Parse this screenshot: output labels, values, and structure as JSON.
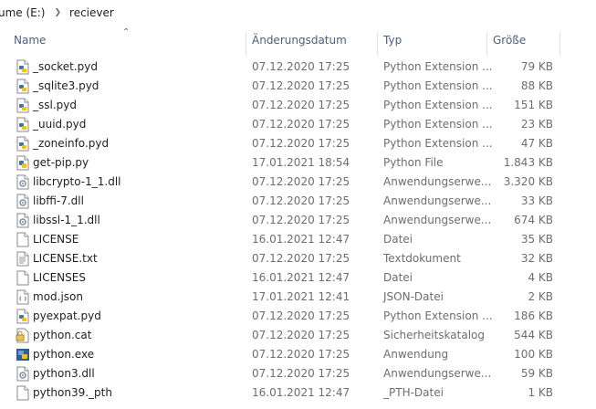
{
  "breadcrumb": {
    "volume": "ume (E:)",
    "folder": "reciever"
  },
  "columns": {
    "name": "Name",
    "date": "Änderungsdatum",
    "type": "Typ",
    "size": "Größe"
  },
  "files": [
    {
      "name": "_socket.pyd",
      "date": "07.12.2020 17:25",
      "type": "Python Extension ...",
      "size": "79 KB",
      "icon": "python-extension-icon"
    },
    {
      "name": "_sqlite3.pyd",
      "date": "07.12.2020 17:25",
      "type": "Python Extension ...",
      "size": "88 KB",
      "icon": "python-extension-icon"
    },
    {
      "name": "_ssl.pyd",
      "date": "07.12.2020 17:25",
      "type": "Python Extension ...",
      "size": "151 KB",
      "icon": "python-extension-icon"
    },
    {
      "name": "_uuid.pyd",
      "date": "07.12.2020 17:25",
      "type": "Python Extension ...",
      "size": "23 KB",
      "icon": "python-extension-icon"
    },
    {
      "name": "_zoneinfo.pyd",
      "date": "07.12.2020 17:25",
      "type": "Python Extension ...",
      "size": "47 KB",
      "icon": "python-extension-icon"
    },
    {
      "name": "get-pip.py",
      "date": "17.01.2021 18:54",
      "type": "Python File",
      "size": "1.843 KB",
      "icon": "python-file-icon"
    },
    {
      "name": "libcrypto-1_1.dll",
      "date": "07.12.2020 17:25",
      "type": "Anwendungserwe...",
      "size": "3.320 KB",
      "icon": "dll-file-icon"
    },
    {
      "name": "libffi-7.dll",
      "date": "07.12.2020 17:25",
      "type": "Anwendungserwe...",
      "size": "33 KB",
      "icon": "dll-file-icon"
    },
    {
      "name": "libssl-1_1.dll",
      "date": "07.12.2020 17:25",
      "type": "Anwendungserwe...",
      "size": "674 KB",
      "icon": "dll-file-icon"
    },
    {
      "name": "LICENSE",
      "date": "16.01.2021 12:47",
      "type": "Datei",
      "size": "35 KB",
      "icon": "blank-file-icon"
    },
    {
      "name": "LICENSE.txt",
      "date": "07.12.2020 17:25",
      "type": "Textdokument",
      "size": "32 KB",
      "icon": "text-file-icon"
    },
    {
      "name": "LICENSES",
      "date": "16.01.2021 12:47",
      "type": "Datei",
      "size": "4 KB",
      "icon": "blank-file-icon"
    },
    {
      "name": "mod.json",
      "date": "17.01.2021 12:41",
      "type": "JSON-Datei",
      "size": "2 KB",
      "icon": "json-file-icon"
    },
    {
      "name": "pyexpat.pyd",
      "date": "07.12.2020 17:25",
      "type": "Python Extension ...",
      "size": "186 KB",
      "icon": "python-extension-icon"
    },
    {
      "name": "python.cat",
      "date": "07.12.2020 17:25",
      "type": "Sicherheitskatalog",
      "size": "544 KB",
      "icon": "security-catalog-icon"
    },
    {
      "name": "python.exe",
      "date": "07.12.2020 17:25",
      "type": "Anwendung",
      "size": "100 KB",
      "icon": "python-exe-icon"
    },
    {
      "name": "python3.dll",
      "date": "07.12.2020 17:25",
      "type": "Anwendungserwe...",
      "size": "59 KB",
      "icon": "dll-file-icon"
    },
    {
      "name": "python39._pth",
      "date": "16.01.2021 12:47",
      "type": "_PTH-Datei",
      "size": "1 KB",
      "icon": "blank-file-icon"
    }
  ]
}
